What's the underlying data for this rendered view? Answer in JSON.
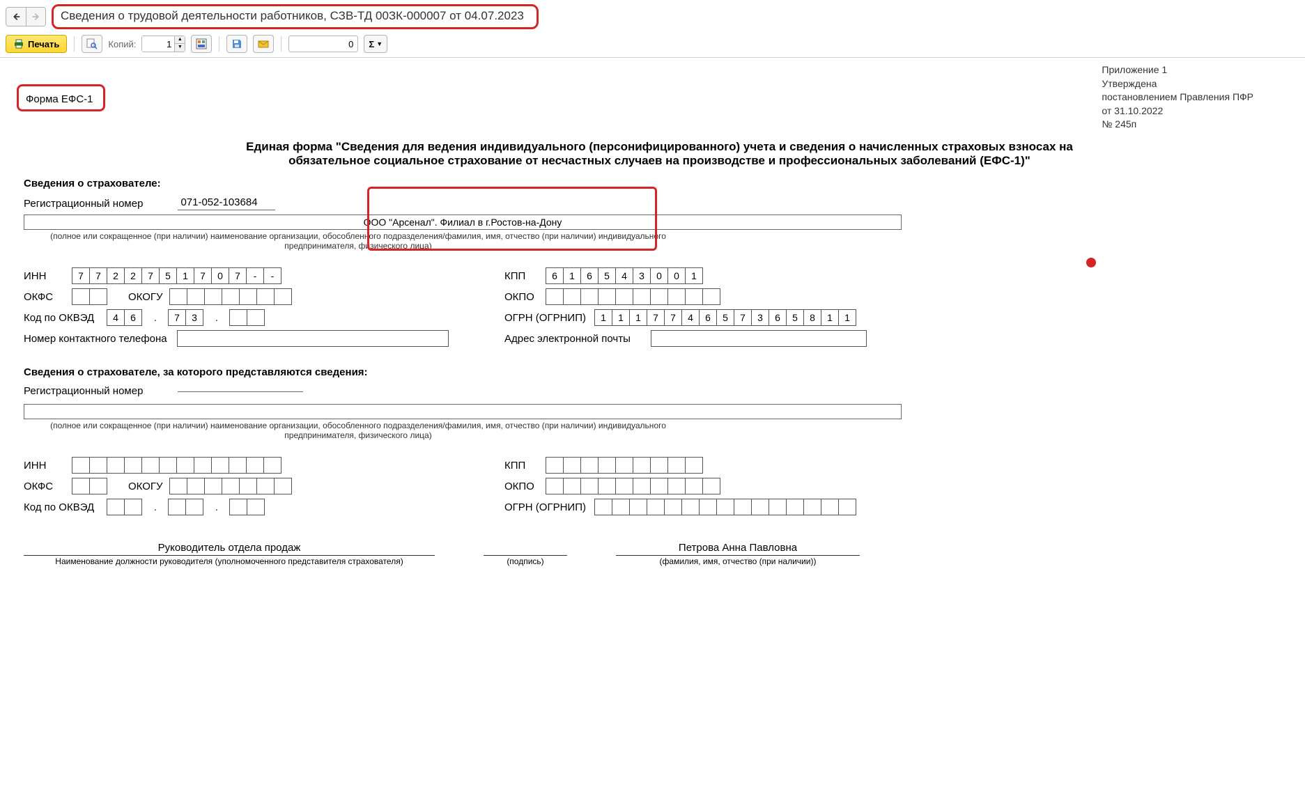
{
  "title": "Сведения о трудовой деятельности работников, СЗВ-ТД 00ЗК-000007 от 04.07.2023",
  "toolbar": {
    "print_label": "Печать",
    "copies_label": "Копий:",
    "copies_value": "1",
    "sum_value": "0",
    "sigma": "Σ"
  },
  "form": {
    "name": "Форма ЕФС-1",
    "approval": {
      "l1": "Приложение 1",
      "l2": "Утверждена",
      "l3": "постановлением Правления ПФР",
      "l4": "от 31.10.2022",
      "l5": "№ 245п"
    },
    "big_title": "Единая форма \"Сведения для ведения индивидуального (персонифицированного) учета и сведения о начисленных страховых взносах на обязательное социальное страхование от несчастных случаев на производстве и профессиональных заболеваний (ЕФС-1)\"",
    "sec1": "Сведения о страхователе:",
    "regnum_label": "Регистрационный номер",
    "regnum_value": "071-052-103684",
    "org_name": "ООО \"Арсенал\". Филиал в г.Ростов-на-Дону",
    "org_hint": "(полное или сокращенное (при наличии) наименование организации, обособленного подразделения/фамилия, имя, отчество (при наличии) индивидуального предпринимателя, физического лица)",
    "inn_label": "ИНН",
    "kpp_label": "КПП",
    "okfs_label": "ОКФС",
    "okogu_label": "ОКОГУ",
    "okpo_label": "ОКПО",
    "okved_label": "Код по ОКВЭД",
    "ogrn_label": "ОГРН (ОГРНИП)",
    "phone_label": "Номер контактного телефона",
    "email_label": "Адрес электронной почты",
    "inn": [
      "7",
      "7",
      "2",
      "2",
      "7",
      "5",
      "1",
      "7",
      "0",
      "7",
      "-",
      "-"
    ],
    "kpp": [
      "6",
      "1",
      "6",
      "5",
      "4",
      "3",
      "0",
      "0",
      "1"
    ],
    "okved1": [
      "4",
      "6"
    ],
    "okved2": [
      "7",
      "3"
    ],
    "ogrn": [
      "1",
      "1",
      "1",
      "7",
      "7",
      "4",
      "6",
      "5",
      "7",
      "3",
      "6",
      "5",
      "8",
      "1",
      "1"
    ],
    "sec2": "Сведения о страхователе, за которого представляются сведения:",
    "regnum_label2": "Регистрационный номер",
    "sig": {
      "position": "Руководитель отдела продаж",
      "position_hint": "Наименование должности руководителя (уполномоченного представителя страхователя)",
      "signature_hint": "(подпись)",
      "fio": "Петрова Анна Павловна",
      "fio_hint": "(фамилия, имя, отчество (при наличии))"
    }
  }
}
